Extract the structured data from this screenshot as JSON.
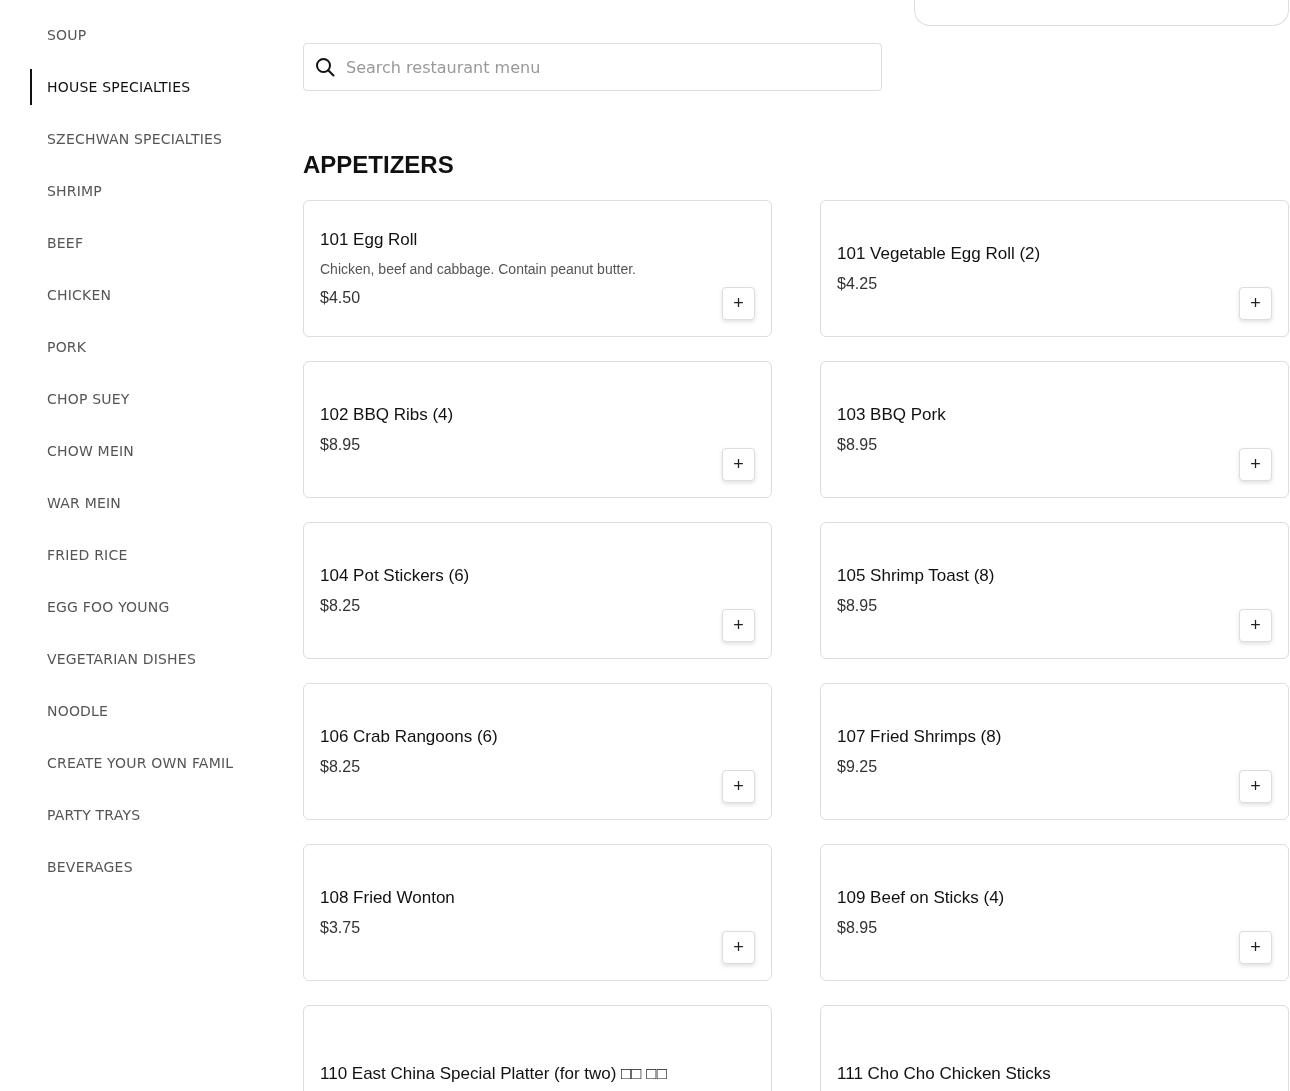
{
  "sidebar": {
    "items": [
      {
        "label": "SOUP",
        "selected": false
      },
      {
        "label": "HOUSE SPECIALTIES",
        "selected": true
      },
      {
        "label": "SZECHWAN SPECIALTIES",
        "selected": false
      },
      {
        "label": "SHRIMP",
        "selected": false
      },
      {
        "label": "BEEF",
        "selected": false
      },
      {
        "label": "CHICKEN",
        "selected": false
      },
      {
        "label": "PORK",
        "selected": false
      },
      {
        "label": "CHOP SUEY",
        "selected": false
      },
      {
        "label": "CHOW MEIN",
        "selected": false
      },
      {
        "label": "WAR MEIN",
        "selected": false
      },
      {
        "label": "FRIED RICE",
        "selected": false
      },
      {
        "label": "EGG FOO YOUNG",
        "selected": false
      },
      {
        "label": "VEGETARIAN DISHES",
        "selected": false
      },
      {
        "label": "NOODLE",
        "selected": false
      },
      {
        "label": "CREATE YOUR OWN FAMIL",
        "selected": false
      },
      {
        "label": "PARTY TRAYS",
        "selected": false
      },
      {
        "label": "BEVERAGES",
        "selected": false
      }
    ]
  },
  "search": {
    "placeholder": "Search restaurant menu"
  },
  "section": {
    "title": "APPETIZERS",
    "items": [
      {
        "name": "101 Egg Roll",
        "description": "Chicken, beef and cabbage. Contain peanut butter.",
        "price": "$4.50",
        "add": "+"
      },
      {
        "name": "101 Vegetable Egg Roll (2)",
        "price": "$4.25",
        "add": "+"
      },
      {
        "name": "102 BBQ Ribs (4)",
        "price": "$8.95",
        "add": "+"
      },
      {
        "name": "103 BBQ Pork",
        "price": "$8.95",
        "add": "+"
      },
      {
        "name": "104 Pot Stickers (6)",
        "price": "$8.25",
        "add": "+"
      },
      {
        "name": "105 Shrimp Toast (8)",
        "price": "$8.95",
        "add": "+"
      },
      {
        "name": "106 Crab Rangoons (6)",
        "price": "$8.25",
        "add": "+"
      },
      {
        "name": "107 Fried Shrimps (8)",
        "price": "$9.25",
        "add": "+"
      },
      {
        "name": "108 Fried Wonton",
        "price": "$3.75",
        "add": "+"
      },
      {
        "name": "109 Beef on Sticks (4)",
        "price": "$8.95",
        "add": "+"
      },
      {
        "name": "110 East China Special Platter (for two) □□ □□"
      },
      {
        "name": "111 Cho Cho Chicken Sticks"
      }
    ]
  }
}
